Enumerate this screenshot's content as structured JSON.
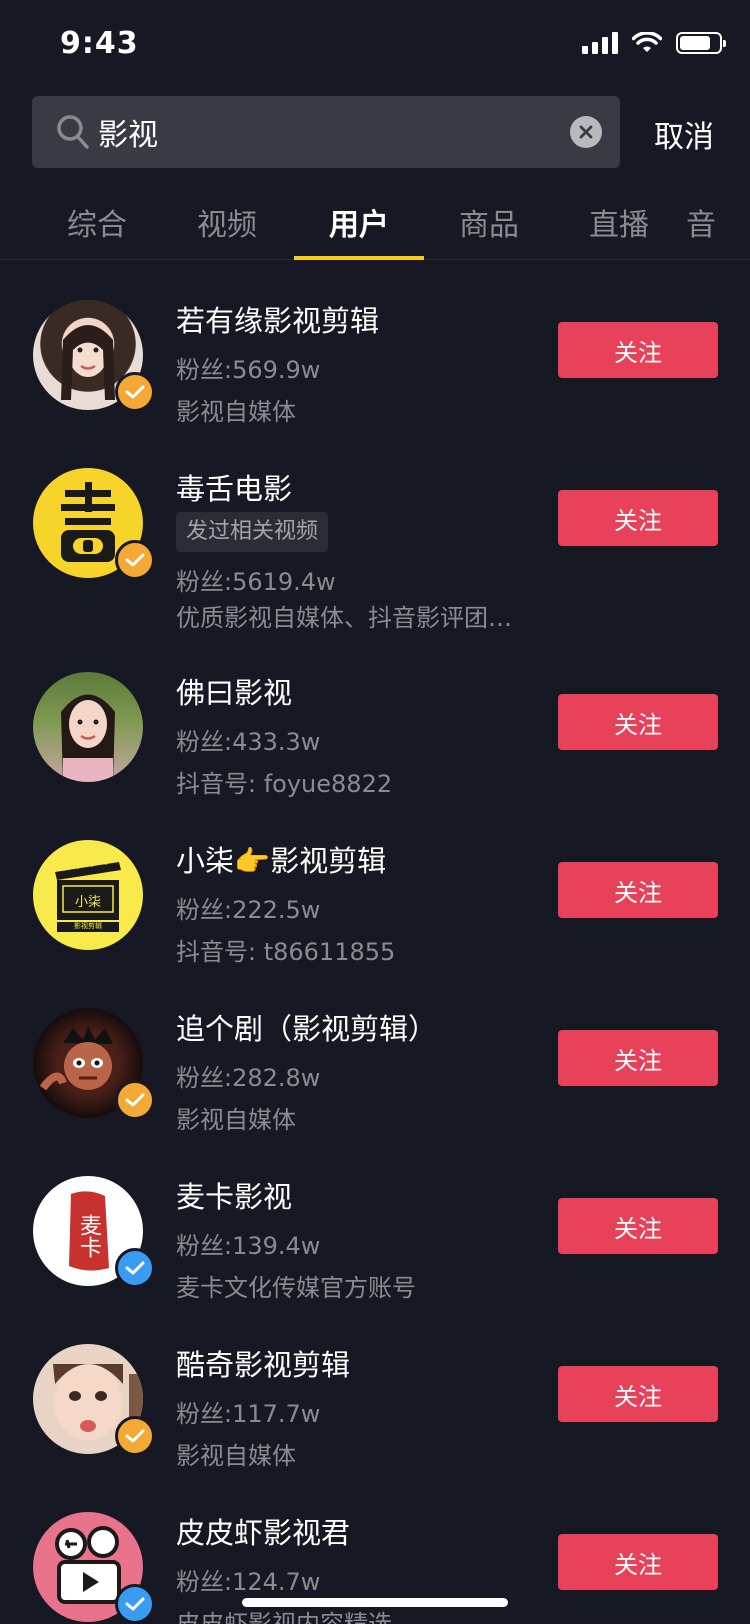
{
  "status": {
    "time": "9:43"
  },
  "search": {
    "value": "影视",
    "cancel_label": "取消"
  },
  "tabs": [
    {
      "label": "综合"
    },
    {
      "label": "视频"
    },
    {
      "label": "用户",
      "active": true
    },
    {
      "label": "商品"
    },
    {
      "label": "直播"
    },
    {
      "label": "音"
    }
  ],
  "users": [
    {
      "name": "若有缘影视剪辑",
      "fans": "粉丝:569.9w",
      "desc": "影视自媒体",
      "badge": "orange",
      "follow": "关注"
    },
    {
      "name": "毒舌电影",
      "tag": "发过相关视频",
      "fans": "粉丝:5619.4w",
      "desc": "优质影视自媒体、抖音影评团…",
      "badge": "orange",
      "follow": "关注"
    },
    {
      "name": "佛曰影视",
      "fans": "粉丝:433.3w",
      "desc": "抖音号: foyue8822",
      "follow": "关注"
    },
    {
      "name": "小柒👉影视剪辑",
      "fans": "粉丝:222.5w",
      "desc": "抖音号: t86611855",
      "follow": "关注"
    },
    {
      "name": "追个剧（影视剪辑）",
      "fans": "粉丝:282.8w",
      "desc": "影视自媒体",
      "badge": "orange",
      "follow": "关注"
    },
    {
      "name": "麦卡影视",
      "fans": "粉丝:139.4w",
      "desc": "麦卡文化传媒官方账号",
      "badge": "blue",
      "follow": "关注"
    },
    {
      "name": "酷奇影视剪辑",
      "fans": "粉丝:117.7w",
      "desc": "影视自媒体",
      "badge": "orange",
      "follow": "关注"
    },
    {
      "name": "皮皮虾影视君",
      "fans": "粉丝:124.7w",
      "desc": "皮皮虾影视内容精选",
      "badge": "blue",
      "follow": "关注"
    }
  ],
  "avatar_text": {
    "u4_top": "小柒",
    "u4_bottom": "影视剪辑",
    "u6": "麦卡"
  },
  "colors": {
    "background": "#161823",
    "follow": "#e8415a",
    "tab_indicator": "#face15",
    "badge_orange": "#f4a835",
    "badge_blue": "#3a9cf0"
  }
}
